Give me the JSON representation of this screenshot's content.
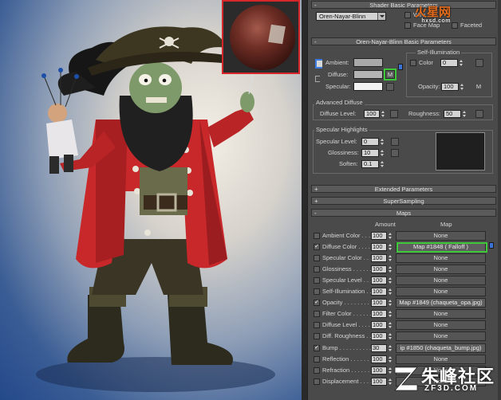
{
  "shader_basic": {
    "rollout_title": "Shader Basic Parameters",
    "shader_type": "Oren-Nayar-Blinn",
    "options": [
      {
        "label": "Wire",
        "checked": false
      },
      {
        "label": "2-Sided",
        "checked": false
      },
      {
        "label": "Face Map",
        "checked": false
      },
      {
        "label": "Faceted",
        "checked": false
      }
    ]
  },
  "onb_basic": {
    "rollout_title": "Oren-Nayar-Blinn Basic Parameters",
    "self_illum_title": "Self-Illumination",
    "ambient_label": "Ambient:",
    "diffuse_label": "Diffuse:",
    "specular_label": "Specular:",
    "ambient_color": "#a9a9a9",
    "diffuse_color": "#b4b4b4",
    "specular_color": "#f2f2f2",
    "map_button": "M",
    "color_label": "Color",
    "color_value": "0",
    "opacity_label": "Opacity:",
    "opacity_value": "100",
    "opacity_map_button": "M"
  },
  "advanced_diffuse": {
    "title": "Advanced Diffuse",
    "diffuse_level_label": "Diffuse Level:",
    "diffuse_level_value": "100",
    "roughness_label": "Roughness:",
    "roughness_value": "50"
  },
  "specular_highlights": {
    "title": "Specular Highlights",
    "specular_level_label": "Specular Level:",
    "specular_level_value": "0",
    "glossiness_label": "Glossiness:",
    "glossiness_value": "10",
    "soften_label": "Soften:",
    "soften_value": "0.1"
  },
  "rollouts": {
    "extended": "Extended Parameters",
    "supersampling": "SuperSampling",
    "maps": "Maps"
  },
  "maps": {
    "amount_header": "Amount",
    "map_header": "Map",
    "rows": [
      {
        "label": "Ambient Color . . . . .",
        "checked": false,
        "amount": "100",
        "map": "None"
      },
      {
        "label": "Diffuse Color . . . . .",
        "checked": true,
        "amount": "100",
        "map": "Map #1848  ( Falloff )"
      },
      {
        "label": "Specular Color . . .",
        "checked": false,
        "amount": "100",
        "map": "None"
      },
      {
        "label": "Glossiness . . . . . . .",
        "checked": false,
        "amount": "100",
        "map": "None"
      },
      {
        "label": "Specular Level . . . .",
        "checked": false,
        "amount": "100",
        "map": "None"
      },
      {
        "label": "Self-Illumination . . .",
        "checked": false,
        "amount": "100",
        "map": "None"
      },
      {
        "label": "Opacity . . . . . . . . .",
        "checked": true,
        "amount": "100",
        "map": "Map #1849 (chaqueta_opa.jpg)"
      },
      {
        "label": "Filter Color . . . . . .",
        "checked": false,
        "amount": "100",
        "map": "None"
      },
      {
        "label": "Diffuse Level . . . . .",
        "checked": false,
        "amount": "100",
        "map": "None"
      },
      {
        "label": "Diff. Roughness . . .",
        "checked": false,
        "amount": "100",
        "map": "None"
      },
      {
        "label": "Bump . . . . . . . . . .",
        "checked": true,
        "amount": "30",
        "map": "ip #1850 (chaqueta_bump.jpg)"
      },
      {
        "label": "Reflection . . . . . . .",
        "checked": false,
        "amount": "100",
        "map": "None"
      },
      {
        "label": "Refraction . . . . . . .",
        "checked": false,
        "amount": "100",
        "map": "None"
      },
      {
        "label": "Displacement . . . . .",
        "checked": false,
        "amount": "100",
        "map": "None"
      }
    ]
  },
  "watermarks": {
    "top_main": "火星网",
    "top_sub": "hxsd.com",
    "bottom_cn": "朱峰社区",
    "bottom_en": "ZF3D.COM"
  }
}
